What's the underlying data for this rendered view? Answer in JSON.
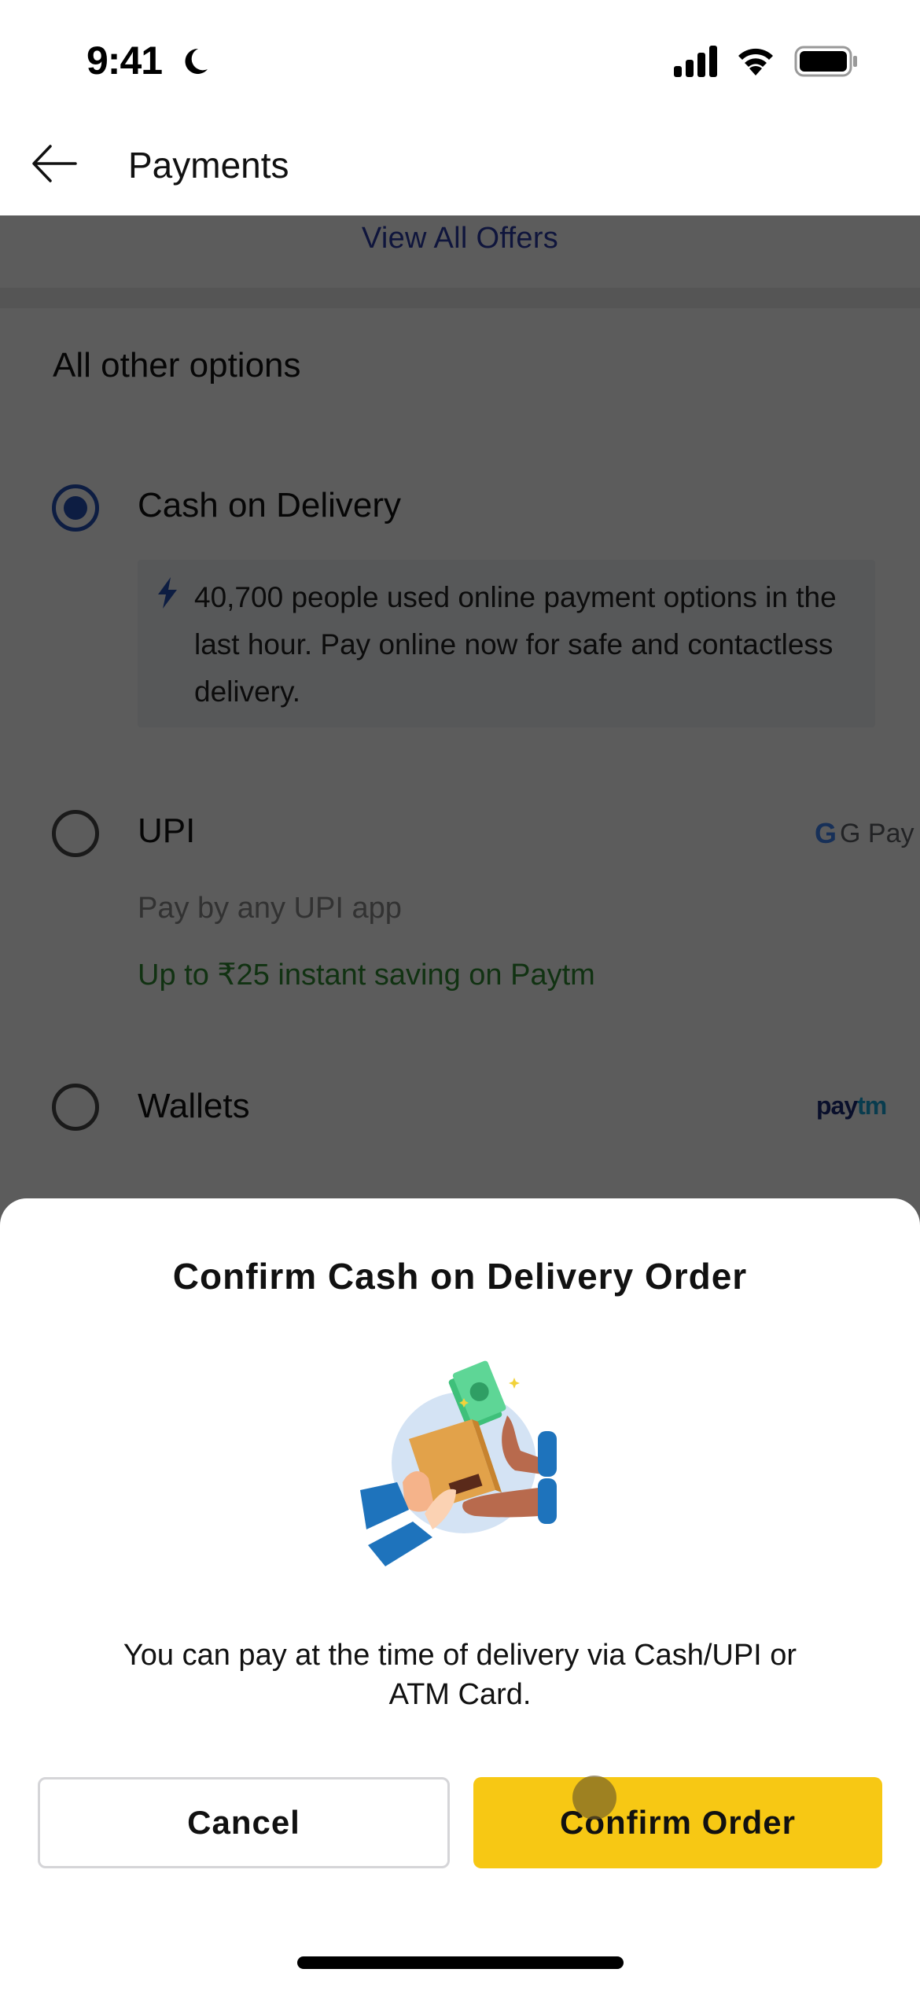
{
  "status_bar": {
    "time": "9:41",
    "icons": [
      "moon-icon",
      "cellular-signal-icon",
      "wifi-icon",
      "battery-icon"
    ]
  },
  "header": {
    "back_icon": "arrow-left-icon",
    "title": "Payments"
  },
  "offers": {
    "link_label": "View All Offers"
  },
  "payment_options": {
    "section_title": "All other options",
    "items": [
      {
        "label": "Cash on Delivery",
        "selected": true,
        "info_icon": "lightning-bolt-icon",
        "info_text": "40,700 people used online payment options in the last hour. Pay online now for safe and contactless delivery."
      },
      {
        "label": "UPI",
        "selected": false,
        "logo": "G Pay",
        "subtitle": "Pay by any UPI app",
        "promo": "Up to ₹25 instant saving on Paytm"
      },
      {
        "label": "Wallets",
        "selected": false,
        "logo_parts": [
          "pay",
          "tm"
        ]
      }
    ]
  },
  "dialog": {
    "title": "Confirm Cash on Delivery Order",
    "illustration": "cash-on-delivery-handover-illustration",
    "body": "You can pay at the time of delivery via Cash/UPI or ATM Card.",
    "cancel_label": "Cancel",
    "confirm_label": "Confirm Order"
  },
  "colors": {
    "accent_blue": "#2650b8",
    "confirm_yellow": "#f7c814",
    "promo_green": "#2f8a33",
    "link_blue": "#2a3aa6"
  }
}
